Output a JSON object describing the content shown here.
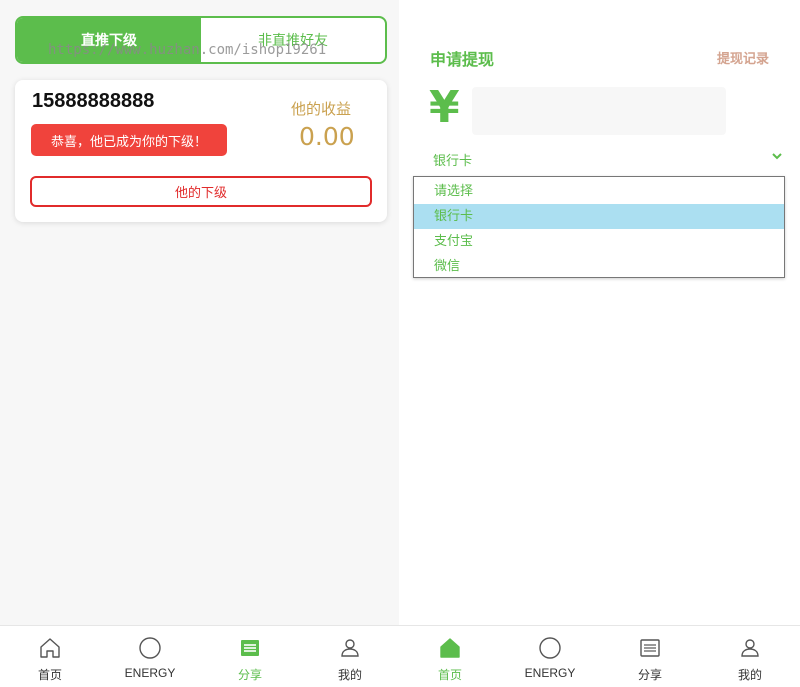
{
  "left": {
    "tabs": [
      {
        "label": "直推下级",
        "active": true
      },
      {
        "label": "非直推好友",
        "active": false
      }
    ],
    "watermark": "https://www.huzhan.com/ishop19261",
    "card": {
      "phone": "15888888888",
      "earnings_label": "他的收益",
      "earnings_value": "0.00",
      "congrats": "恭喜，他已成为你的下级！",
      "subordinates_button": "他的下级"
    }
  },
  "right": {
    "title": "申请提现",
    "records_link": "提现记录",
    "currency_symbol": "¥",
    "amount_value": "",
    "method_selected": "银行卡",
    "method_options": [
      "请选择",
      "银行卡",
      "支付宝",
      "微信"
    ],
    "method_highlighted_index": 1
  },
  "nav_left": [
    {
      "label": "首页",
      "icon": "home-icon",
      "active": false
    },
    {
      "label": "ENERGY",
      "icon": "circle-icon",
      "active": false
    },
    {
      "label": "分享",
      "icon": "share-icon",
      "active": true
    },
    {
      "label": "我的",
      "icon": "user-icon",
      "active": false
    }
  ],
  "nav_right": [
    {
      "label": "首页",
      "icon": "home-icon",
      "active": true
    },
    {
      "label": "ENERGY",
      "icon": "circle-icon",
      "active": false
    },
    {
      "label": "分享",
      "icon": "share-icon",
      "active": false
    },
    {
      "label": "我的",
      "icon": "user-icon",
      "active": false
    }
  ],
  "colors": {
    "brand_green": "#5cbd4c",
    "alert_red": "#f0433c",
    "border_red": "#e12b2b",
    "gold": "#caa14f",
    "records_link": "#d4a490",
    "option_highlight": "#abdff1"
  }
}
